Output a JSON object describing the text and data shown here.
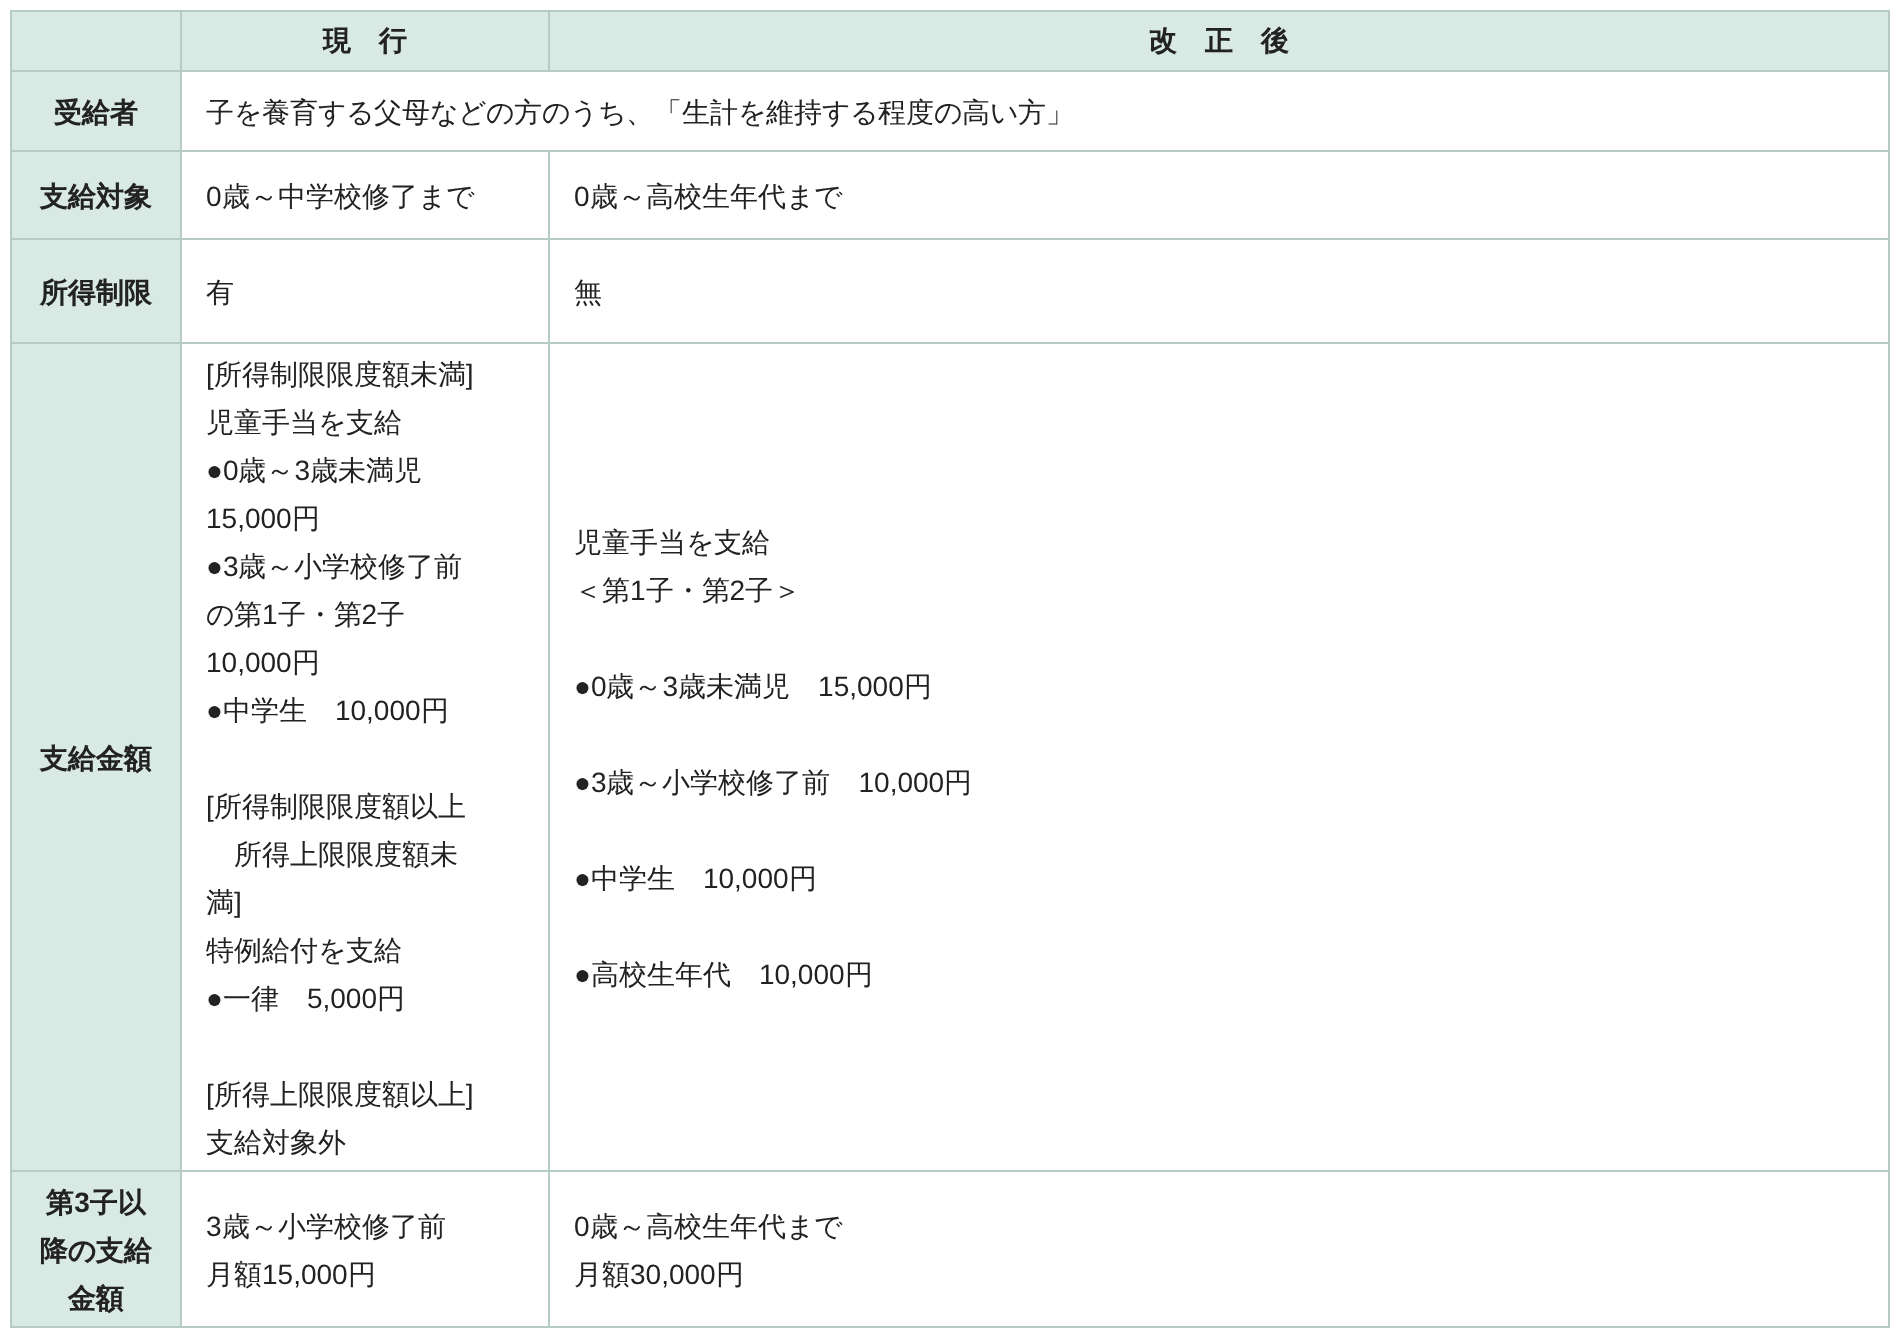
{
  "table": {
    "columns": [
      "現　行",
      "改　正　後"
    ],
    "rows": [
      {
        "header": "受給者",
        "cells": [
          {
            "colspan": 2,
            "blocks": [
              [
                "子を養育する父母などの方のうち、「生計を維持する程度の高い方」"
              ]
            ]
          }
        ]
      },
      {
        "header": "支給対象",
        "cells": [
          {
            "blocks": [
              [
                "0歳～中学校修了まで"
              ]
            ]
          },
          {
            "blocks": [
              [
                "0歳～高校生年代まで"
              ]
            ]
          }
        ]
      },
      {
        "header": "所得制限",
        "cells": [
          {
            "blocks": [
              [
                "有"
              ]
            ]
          },
          {
            "blocks": [
              [
                "無"
              ]
            ]
          }
        ]
      },
      {
        "header": "支給金額",
        "cells": [
          {
            "blocks": [
              [
                "[所得制限限度額未満]",
                "児童手当を支給",
                "●0歳～3歳未満児",
                "15,000円",
                "●3歳～小学校修了前",
                "の第1子・第2子",
                "10,000円",
                "●中学生　10,000円"
              ],
              [
                "[所得制限限度額以上",
                "　所得上限限度額未満]",
                "特例給付を支給",
                "●一律　5,000円"
              ],
              [
                "[所得上限限度額以上]",
                "支給対象外"
              ]
            ]
          },
          {
            "blocks": [
              [
                "児童手当を支給",
                "＜第1子・第2子＞"
              ],
              [
                "●0歳～3歳未満児　15,000円"
              ],
              [
                "●3歳～小学校修了前　10,000円"
              ],
              [
                "●中学生　10,000円"
              ],
              [
                "●高校生年代　10,000円"
              ]
            ]
          }
        ]
      },
      {
        "header": "第3子以降の支給金額",
        "cells": [
          {
            "blocks": [
              [
                "3歳～小学校修了前",
                "月額15,000円"
              ]
            ]
          },
          {
            "blocks": [
              [
                "0歳～高校生年代まで",
                "月額30,000円"
              ]
            ]
          }
        ]
      }
    ]
  }
}
